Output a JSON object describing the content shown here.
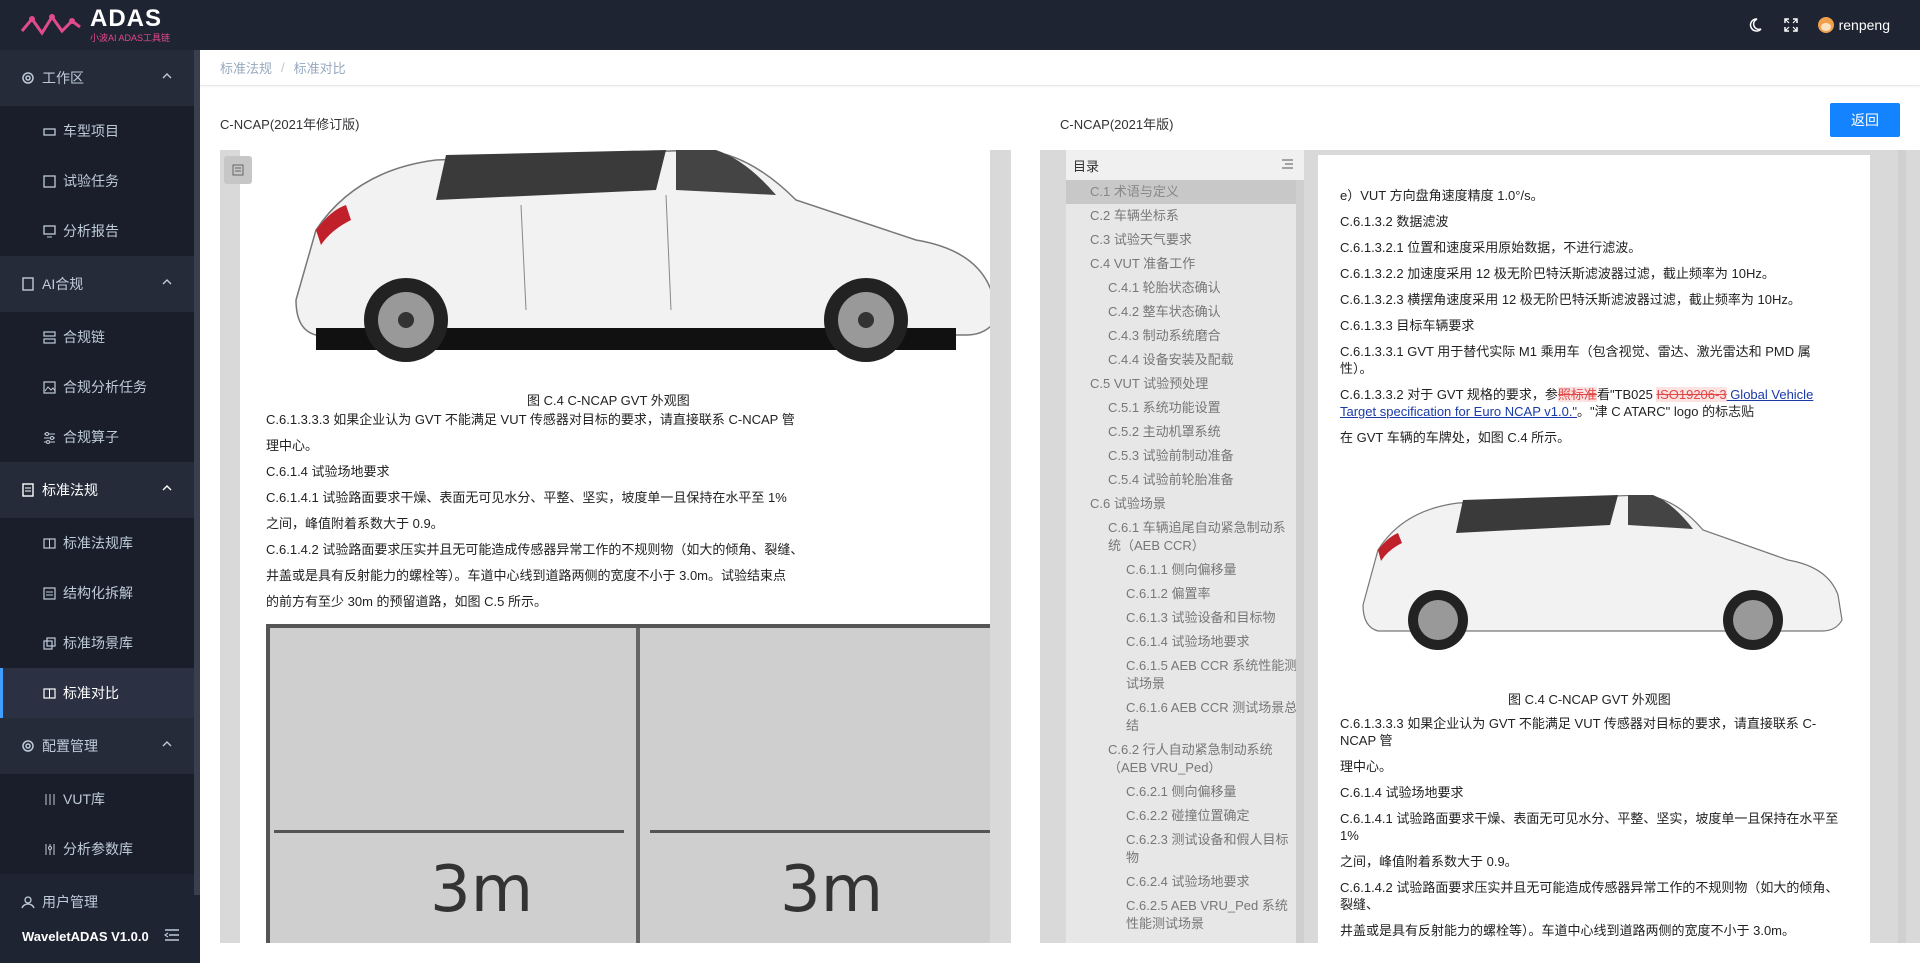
{
  "brand": {
    "title": "ADAS",
    "subtitle": "小波AI ADAS工具链"
  },
  "header": {
    "user": "renpeng",
    "icons": [
      "moon-icon",
      "fullscreen-icon",
      "avatar"
    ]
  },
  "sidebar": {
    "groups": [
      {
        "label": "工作区",
        "icon": "gear-icon",
        "items": [
          "车型项目",
          "试验任务",
          "分析报告"
        ]
      },
      {
        "label": "AI合规",
        "icon": "badge-icon",
        "items": [
          "合规链",
          "合规分析任务",
          "合规算子"
        ]
      },
      {
        "label": "标准法规",
        "icon": "book-icon",
        "items": [
          "标准法规库",
          "结构化拆解",
          "标准场景库",
          "标准对比"
        ]
      },
      {
        "label": "配置管理",
        "icon": "gear-icon",
        "items": [
          "VUT库",
          "分析参数库"
        ]
      },
      {
        "label": "用户管理",
        "icon": "user-icon",
        "items": []
      }
    ],
    "active_item": "标准对比",
    "footer": "WaveletADAS  V1.0.0"
  },
  "breadcrumb": [
    "标准法规",
    "标准对比"
  ],
  "left_doc": {
    "title": "C-NCAP(2021年修订版)",
    "caption": "图 C.4 C-NCAP GVT 外观图",
    "paragraphs": [
      "C.6.1.3.3.3 如果企业认为 GVT 不能满足 VUT 传感器对目标的要求，请直接联系 C-NCAP 管",
      "理中心。",
      "C.6.1.4 试验场地要求",
      "C.6.1.4.1 试验路面要求干燥、表面无可见水分、平整、坚实，坡度单一且保持在水平至 1%",
      "之间，峰值附着系数大于 0.9。",
      "C.6.1.4.2 试验路面要求压实并且无可能造成传感器异常工作的不规则物（如大的倾角、裂缝、",
      "井盖或是具有反射能力的螺栓等）。车道中心线到道路两侧的宽度不小于 3.0m。试验结束点",
      "的前方有至少 30m 的预留道路，如图 C.5 所示。"
    ],
    "road_labels": [
      "3m",
      "3m"
    ]
  },
  "right_doc": {
    "title": "C-NCAP(2021年版)",
    "back_label": "返回",
    "toc_title": "目录",
    "toc": [
      {
        "level": 1,
        "text": "C.1 术语与定义",
        "selected": true
      },
      {
        "level": 1,
        "text": "C.2 车辆坐标系"
      },
      {
        "level": 1,
        "text": "C.3 试验天气要求"
      },
      {
        "level": 1,
        "text": "C.4 VUT 准备工作",
        "expand": true
      },
      {
        "level": 2,
        "text": "C.4.1 轮胎状态确认"
      },
      {
        "level": 2,
        "text": "C.4.2 整车状态确认"
      },
      {
        "level": 2,
        "text": "C.4.3 制动系统磨合"
      },
      {
        "level": 2,
        "text": "C.4.4 设备安装及配载"
      },
      {
        "level": 1,
        "text": "C.5 VUT 试验预处理",
        "expand": true
      },
      {
        "level": 2,
        "text": "C.5.1 系统功能设置"
      },
      {
        "level": 2,
        "text": "C.5.2 主动机罩系统"
      },
      {
        "level": 2,
        "text": "C.5.3 试验前制动准备"
      },
      {
        "level": 2,
        "text": "C.5.4 试验前轮胎准备"
      },
      {
        "level": 1,
        "text": "C.6 试验场景",
        "expand": true
      },
      {
        "level": 2,
        "text": "C.6.1 车辆追尾自动紧急制动系统（AEB CCR）",
        "expand": true
      },
      {
        "level": 3,
        "text": "C.6.1.1 侧向偏移量"
      },
      {
        "level": 3,
        "text": "C.6.1.2 偏置率"
      },
      {
        "level": 3,
        "text": "C.6.1.3 试验设备和目标物"
      },
      {
        "level": 3,
        "text": "C.6.1.4 试验场地要求"
      },
      {
        "level": 3,
        "text": "C.6.1.5 AEB CCR 系统性能测试场景"
      },
      {
        "level": 3,
        "text": "C.6.1.6 AEB CCR 测试场景总结"
      },
      {
        "level": 2,
        "text": "C.6.2 行人自动紧急制动系统（AEB VRU_Ped）",
        "expand": true
      },
      {
        "level": 3,
        "text": "C.6.2.1 侧向偏移量"
      },
      {
        "level": 3,
        "text": "C.6.2.2 碰撞位置确定"
      },
      {
        "level": 3,
        "text": "C.6.2.3 测试设备和假人目标物"
      },
      {
        "level": 3,
        "text": "C.6.2.4 试验场地要求"
      },
      {
        "level": 3,
        "text": "C.6.2.5 AEB VRU_Ped 系统性能测试场景"
      }
    ],
    "lines_top": [
      "e）VUT 方向盘角速度精度 1.0°/s。",
      "C.6.1.3.2 数据滤波",
      "C.6.1.3.2.1 位置和速度采用原始数据，不进行滤波。",
      "C.6.1.3.2.2 加速度采用 12 极无阶巴特沃斯滤波器过滤，截止频率为 10Hz。",
      "C.6.1.3.2.3 横摆角速度采用 12 极无阶巴特沃斯滤波器过滤，截止频率为 10Hz。",
      "C.6.1.3.3 目标车辆要求",
      "C.6.1.3.3.1 GVT 用于替代实际 M1 乘用车（包含视觉、雷达、激光雷达和 PMD 属性）。"
    ],
    "diff_line": {
      "prefix": "C.6.1.3.3.2 对于 GVT 规格的要求，参",
      "strike1": "照标准",
      "mid1": "看\"TB025 ",
      "strike2": "ISO19206-3",
      "link": " Global Vehicle Target specification for Euro NCAP v1.0.\"",
      "suffix": "。\"津 C ATARC\" logo 的标志贴",
      "cont": "在 GVT 车辆的车牌处，如图 C.4 所示。"
    },
    "caption": "图 C.4 C-NCAP GVT 外观图",
    "lines_bottom": [
      "C.6.1.3.3.3 如果企业认为 GVT 不能满足 VUT 传感器对目标的要求，请直接联系 C-NCAP 管",
      "理中心。",
      "C.6.1.4 试验场地要求",
      "C.6.1.4.1 试验路面要求干燥、表面无可见水分、平整、坚实，坡度单一且保持在水平至 1%",
      "之间，峰值附着系数大于 0.9。",
      "C.6.1.4.2 试验路面要求压实并且无可能造成传感器异常工作的不规则物（如大的倾角、裂缝、",
      "井盖或是具有反射能力的螺栓等）。车道中心线到道路两侧的宽度不小于 3.0m。"
    ]
  },
  "colors": {
    "sidebar_bg": "#1f2433",
    "accent": "#409eff",
    "button": "#1483ff",
    "brand_pink": "#e14a8c"
  }
}
